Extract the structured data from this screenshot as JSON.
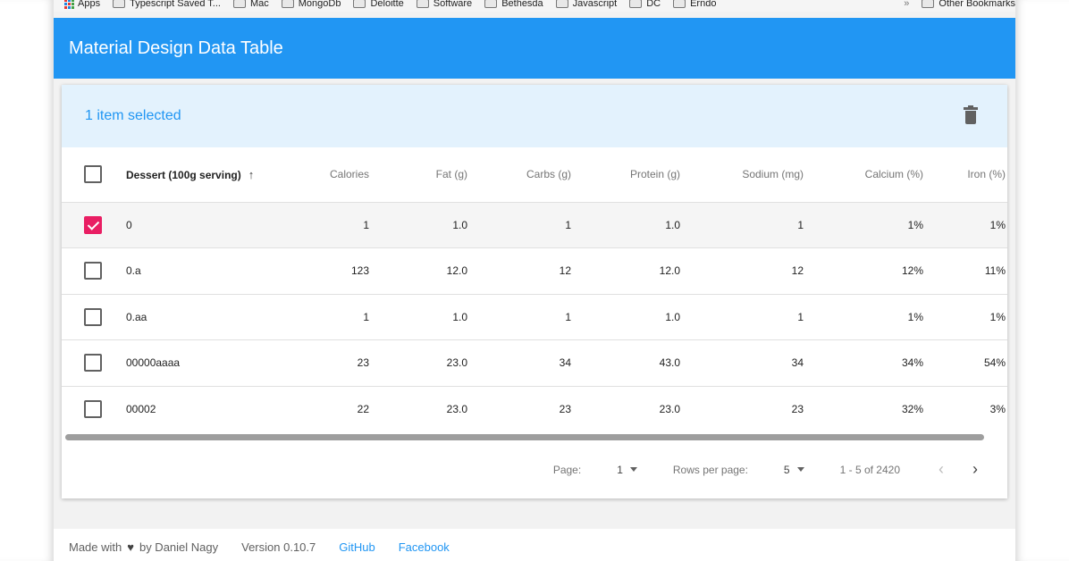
{
  "bookmarks": {
    "items": [
      "Apps",
      "Typescript Saved T...",
      "Mac",
      "MongoDb",
      "Deloitte",
      "Software",
      "Bethesda",
      "Javascript",
      "DC",
      "Erndo"
    ],
    "more": "»",
    "other": "Other Bookmarks"
  },
  "appbar": {
    "title": "Material Design Data Table"
  },
  "toolbar": {
    "selected_text": "1 item selected"
  },
  "table": {
    "columns": [
      "Dessert (100g serving)",
      "Calories",
      "Fat (g)",
      "Carbs (g)",
      "Protein (g)",
      "Sodium (mg)",
      "Calcium (%)",
      "Iron (%)"
    ],
    "sort_icon": "arrow-up-icon",
    "rows": [
      {
        "checked": true,
        "cells": [
          "0",
          "1",
          "1.0",
          "1",
          "1.0",
          "1",
          "1%",
          "1%"
        ]
      },
      {
        "checked": false,
        "cells": [
          "0.a",
          "123",
          "12.0",
          "12",
          "12.0",
          "12",
          "12%",
          "11%"
        ]
      },
      {
        "checked": false,
        "cells": [
          "0.aa",
          "1",
          "1.0",
          "1",
          "1.0",
          "1",
          "1%",
          "1%"
        ]
      },
      {
        "checked": false,
        "cells": [
          "00000aaaa",
          "23",
          "23.0",
          "34",
          "43.0",
          "34",
          "34%",
          "54%"
        ]
      },
      {
        "checked": false,
        "cells": [
          "00002",
          "22",
          "23.0",
          "23",
          "23.0",
          "23",
          "32%",
          "3%"
        ]
      }
    ]
  },
  "pagination": {
    "page_label": "Page:",
    "page_value": "1",
    "rows_label": "Rows per page:",
    "rows_value": "5",
    "range": "1 - 5 of 2420",
    "prev": "‹",
    "next": "›"
  },
  "footer": {
    "made_with": "Made with",
    "heart": "♥",
    "by": "by Daniel Nagy",
    "version": "Version 0.10.7",
    "github": "GitHub",
    "facebook": "Facebook"
  },
  "colors": {
    "primary": "#2196f3",
    "accent": "#e91e63",
    "selected_toolbar": "#e3f2fd"
  }
}
